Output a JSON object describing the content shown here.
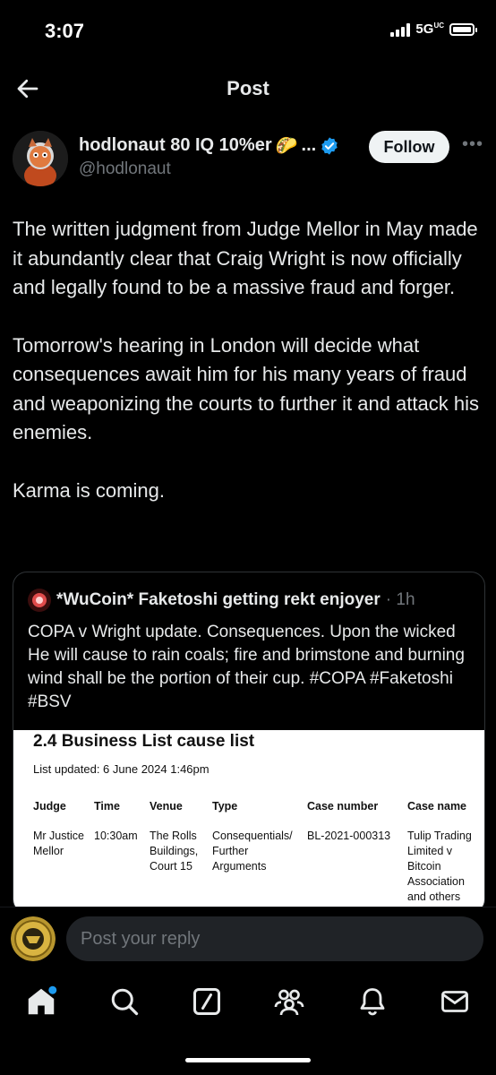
{
  "status": {
    "time": "3:07",
    "network": "5G",
    "network_sub": "UC"
  },
  "nav": {
    "title": "Post"
  },
  "author": {
    "name": "hodlonaut 80 IQ 10%er",
    "name_emoji": "🌮",
    "ellipsis": "...",
    "handle": "@hodlonaut",
    "follow_label": "Follow"
  },
  "post": {
    "paragraphs": [
      "The written judgment from Judge Mellor in May made it abundantly clear that Craig Wright is now officially and legally found to be a massive fraud and forger.",
      "Tomorrow's hearing in London will decide what consequences await him for his many years of fraud and weaponizing the courts to further it and attack his enemies.",
      "Karma is coming."
    ]
  },
  "quote": {
    "name": "*WuCoin* Faketoshi getting rekt enjoyer",
    "time": "· 1h",
    "text": "COPA v Wright update. Consequences. Upon the wicked He will cause to rain coals; fire and brimstone and burning wind shall be the portion of their cup.  #COPA #Faketoshi #BSV",
    "image": {
      "title": "2.4 Business List cause list",
      "updated": "List updated: 6 June 2024 1:46pm",
      "headers": [
        "Judge",
        "Time",
        "Venue",
        "Type",
        "Case number",
        "Case name"
      ],
      "row": [
        "Mr Justice Mellor",
        "10:30am",
        "The Rolls Buildings, Court 15",
        "Consequentials/ Further Arguments",
        "BL-2021-000313",
        "Tulip Trading Limited v Bitcoin Association and others"
      ]
    }
  },
  "reply": {
    "placeholder": "Post your reply"
  },
  "tabs": [
    "home-icon",
    "search-icon",
    "grok-icon",
    "communities-icon",
    "notifications-icon",
    "messages-icon"
  ],
  "colors": {
    "accent": "#1d9bf0",
    "muted": "#71767b",
    "verified": "#1d9bf0"
  }
}
